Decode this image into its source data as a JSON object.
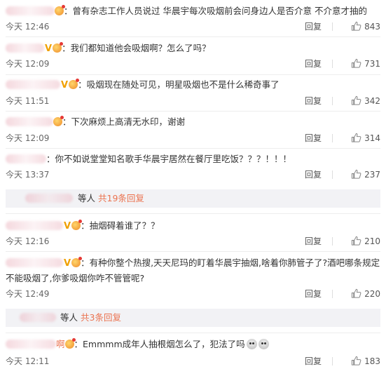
{
  "ui": {
    "reply_label": "回复",
    "accent": "#eb7350"
  },
  "comments": [
    {
      "suffix": "：曾有杂志工作人员说过 华晨宇每次吸烟前会问身边人是否介意 不介意才抽的",
      "time": "今天 12:46",
      "likes": "843"
    },
    {
      "suffix": "：我们都知道他会吸烟啊？怎么了吗？",
      "time": "今天 12:09",
      "likes": "731"
    },
    {
      "suffix": "：吸烟现在随处可见，明星吸烟也不是什么稀奇事了",
      "time": "今天 11:51",
      "likes": "342"
    },
    {
      "suffix": "：下次麻烦上高清无水印，谢谢",
      "time": "今天 12:09",
      "likes": "314"
    },
    {
      "suffix": "：你不如说堂堂知名歌手华晨宇居然在餐厅里吃饭？？？！！！",
      "time": "今天 13:37",
      "likes": "237"
    },
    {
      "suffix": "：抽烟碍着谁了？？",
      "time": "今天 12:16",
      "likes": "210"
    },
    {
      "suffix": "：有种你整个热搜,天天尼玛的盯着华晨宇抽烟,啥着你肺管子了?酒吧哪条规定不能吸烟了,你爹吸烟你咋不管管呢?",
      "time": "今天 12:49",
      "likes": "220"
    },
    {
      "prefix": "啊",
      "suffix": "：Emmmm成年人抽根烟怎么了，犯法了吗",
      "time": "今天 12:11",
      "likes": "183"
    }
  ],
  "expanders": [
    {
      "text": "等人",
      "count": "共19条回复"
    },
    {
      "text": "等人",
      "count": "共3条回复"
    }
  ]
}
